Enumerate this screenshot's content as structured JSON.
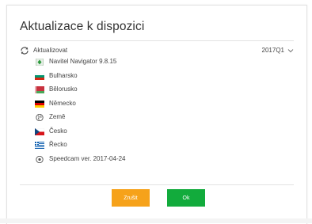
{
  "dialog": {
    "title": "Aktualizace k dispozici",
    "update_label": "Aktualizovat",
    "version": "2017Q1",
    "items": [
      {
        "label": "Navitel Navigator 9.8.15",
        "icon": "navitel-app-icon"
      },
      {
        "label": "Bulharsko",
        "icon": "flag-bulgaria-icon"
      },
      {
        "label": "Bělorusko",
        "icon": "flag-belarus-icon"
      },
      {
        "label": "Německo",
        "icon": "flag-germany-icon"
      },
      {
        "label": "Země",
        "icon": "globe-icon"
      },
      {
        "label": "Česko",
        "icon": "flag-czechia-icon"
      },
      {
        "label": "Řecko",
        "icon": "flag-greece-icon"
      },
      {
        "label": "Speedcam ver. 2017-04-24",
        "icon": "speedcam-icon"
      }
    ],
    "cancel_label": "Zrušit",
    "ok_label": "Ok"
  },
  "colors": {
    "cancel": "#f6a21a",
    "ok": "#12ab3c"
  }
}
